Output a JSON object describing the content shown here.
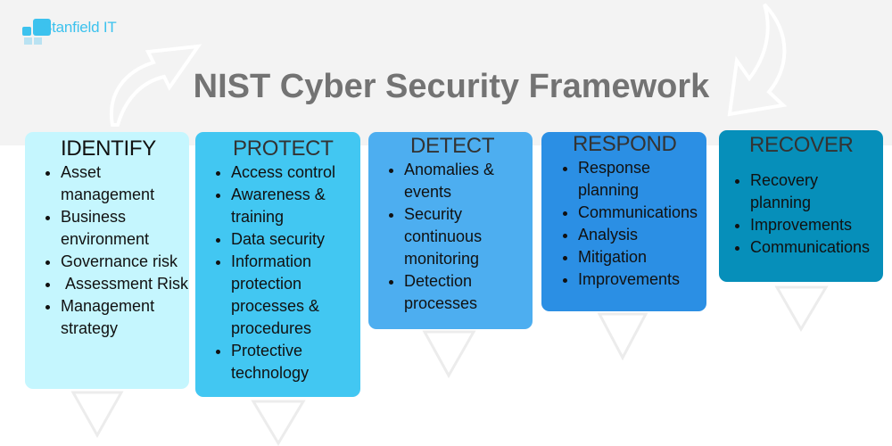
{
  "logo": {
    "text": "Stanfield IT"
  },
  "title": "NIST Cyber Security Framework",
  "colors": {
    "background_band": "#f3f3f3",
    "title": "#737373",
    "logo": "#3cc2ee",
    "identify": "#c5f6fe",
    "protect": "#42c7f2",
    "detect": "#4daef0",
    "respond": "#2b8fe4",
    "recover": "#068fba"
  },
  "functions": [
    {
      "name": "IDENTIFY",
      "items": [
        "Asset management",
        "Business environment",
        "Governance risk",
        " Assessment Risk",
        "Management strategy"
      ]
    },
    {
      "name": "PROTECT",
      "items": [
        "Access control",
        "Awareness & training",
        "Data security",
        "Information protection processes & procedures",
        "Protective technology"
      ]
    },
    {
      "name": "DETECT",
      "items": [
        "Anomalies & events",
        "Security continuous monitoring",
        "Detection processes"
      ]
    },
    {
      "name": "RESPOND",
      "items": [
        "Response planning",
        "Communications",
        "Analysis",
        "Mitigation",
        "Improvements"
      ]
    },
    {
      "name": "RECOVER",
      "items": [
        "Recovery planning",
        "Improvements",
        "Communications"
      ]
    }
  ],
  "icons": {
    "curved_arrow_up": "curved-arrow-up-right",
    "curved_arrow_down": "curved-arrow-down-left",
    "triangle": "down-triangle-outline"
  }
}
